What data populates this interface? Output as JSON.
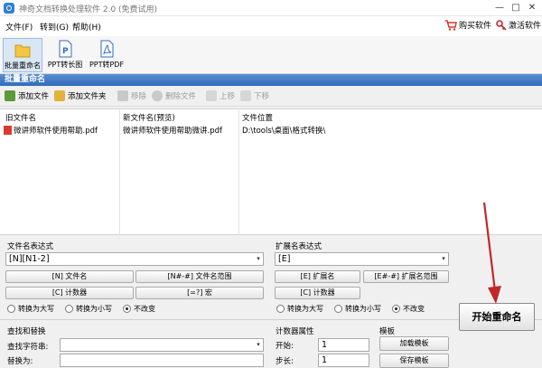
{
  "app": {
    "title": "神奇文档转换处理软件 2.0 (免费试用)"
  },
  "window_controls": {
    "minimize": "—",
    "restore": "□",
    "close": "✕"
  },
  "menu": {
    "file": "文件(F)",
    "goto": "转到(G)",
    "help": "帮助(H)",
    "buy": "购买软件",
    "activate": "激活软件"
  },
  "toolbar": {
    "batch_rename": "批量重命名",
    "ppt_long_image": "PPT转长图",
    "ppt_pdf": "PPT转PDF"
  },
  "section": {
    "title": "批量重命名"
  },
  "list_tools": {
    "add_file": "添加文件",
    "add_folder": "添加文件夹",
    "remove": "移除",
    "delete_file": "删除文件",
    "move_up": "上移",
    "move_down": "下移"
  },
  "table": {
    "headers": [
      "旧文件名",
      "新文件名(预览)",
      "文件位置"
    ],
    "rows": [
      {
        "old": "微讲师软件使用帮助.pdf",
        "new": "微讲师软件使用帮助微讲.pdf",
        "location": "D:\\tools\\桌面\\格式转换\\"
      }
    ]
  },
  "filename_expr": {
    "label": "文件名表达式",
    "value": "[N][N1-2]",
    "btn_filename": "[N] 文件名",
    "btn_range": "[N#-#] 文件名范围",
    "btn_counter": "[C] 计数器",
    "btn_macro": "[=?] 宏",
    "case_options": [
      "转换为大写",
      "转换为小写",
      "不改变"
    ],
    "case_selected": 2
  },
  "ext_expr": {
    "label": "扩展名表达式",
    "value": "[E]",
    "btn_ext": "[E] 扩展名",
    "btn_range": "[E#-#] 扩展名范围",
    "btn_counter": "[C] 计数器",
    "case_options": [
      "转换为大写",
      "转换为小写",
      "不改变"
    ],
    "case_selected": 2
  },
  "find_replace": {
    "label": "查找和替换",
    "find_label": "查找字符串:",
    "replace_label": "替换为:"
  },
  "counter": {
    "label": "计数器属性",
    "start_label": "开始:",
    "start_value": "1",
    "step_label": "步长:",
    "step_value": "1"
  },
  "template": {
    "label": "模板",
    "load": "加载模板",
    "save": "保存模板"
  },
  "start": {
    "label": "开始重命名"
  },
  "colors": {
    "accent": "#2f6cbc",
    "arrow": "#c0282a"
  }
}
